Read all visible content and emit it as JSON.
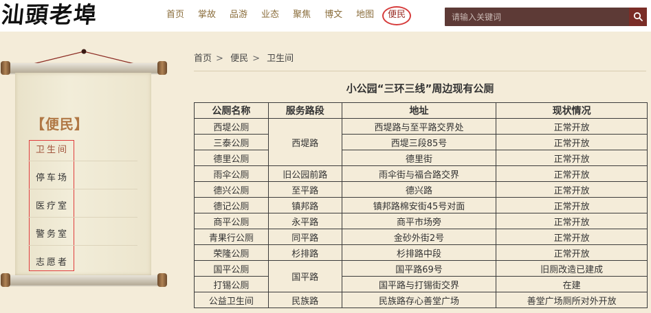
{
  "site": {
    "logo_text": "汕頭老埠"
  },
  "nav": {
    "items": [
      "首页",
      "掌故",
      "品游",
      "业态",
      "聚焦",
      "博文",
      "地图",
      "便民"
    ],
    "active_index": 7
  },
  "search": {
    "placeholder": "请输入关键词"
  },
  "sidebar": {
    "title": "【便民】",
    "items": [
      "卫生间",
      "停车场",
      "医疗室",
      "警务室",
      "志愿者"
    ],
    "active_index": 0
  },
  "breadcrumb": {
    "items": [
      "首页",
      "便民",
      "卫生间"
    ],
    "separator": ">"
  },
  "table": {
    "title": "小公园“三环三线”周边现有公厕",
    "headers": [
      "公厕名称",
      "服务路段",
      "地址",
      "现状情况"
    ],
    "rows": [
      [
        "西堤公厕",
        "西堤路",
        "西堤路与至平路交界处",
        "正常开放"
      ],
      [
        "三泰公厕",
        "",
        "西堤三段85号",
        "正常开放"
      ],
      [
        "德里公厕",
        "",
        "德里街",
        "正常开放"
      ],
      [
        "雨伞公厕",
        "旧公园前路",
        "雨伞街与福合路交界",
        "正常开放"
      ],
      [
        "德兴公厕",
        "至平路",
        "德兴路",
        "正常开放"
      ],
      [
        "德记公厕",
        "镇邦路",
        "镇邦路棉安街45号对面",
        "正常开放"
      ],
      [
        "商平公厕",
        "永平路",
        "商平市场旁",
        "正常开放"
      ],
      [
        "青果行公厕",
        "同平路",
        "金砂外街2号",
        "正常开放"
      ],
      [
        "荣隆公厕",
        "杉排路",
        "杉排路中段",
        "正常开放"
      ],
      [
        "国平公厕",
        "国平路",
        "国平路69号",
        "旧厕改造已建成"
      ],
      [
        "打锡公厕",
        "",
        "国平路与打锡街交界",
        "在建"
      ],
      [
        "公益卫生间",
        "民族路",
        "民族路存心善堂广场",
        "善堂广场厕所对外开放"
      ]
    ]
  },
  "colors": {
    "accent": "#7a2d27",
    "nav_text": "#8a6d3b",
    "background": "#f4ecd9"
  }
}
